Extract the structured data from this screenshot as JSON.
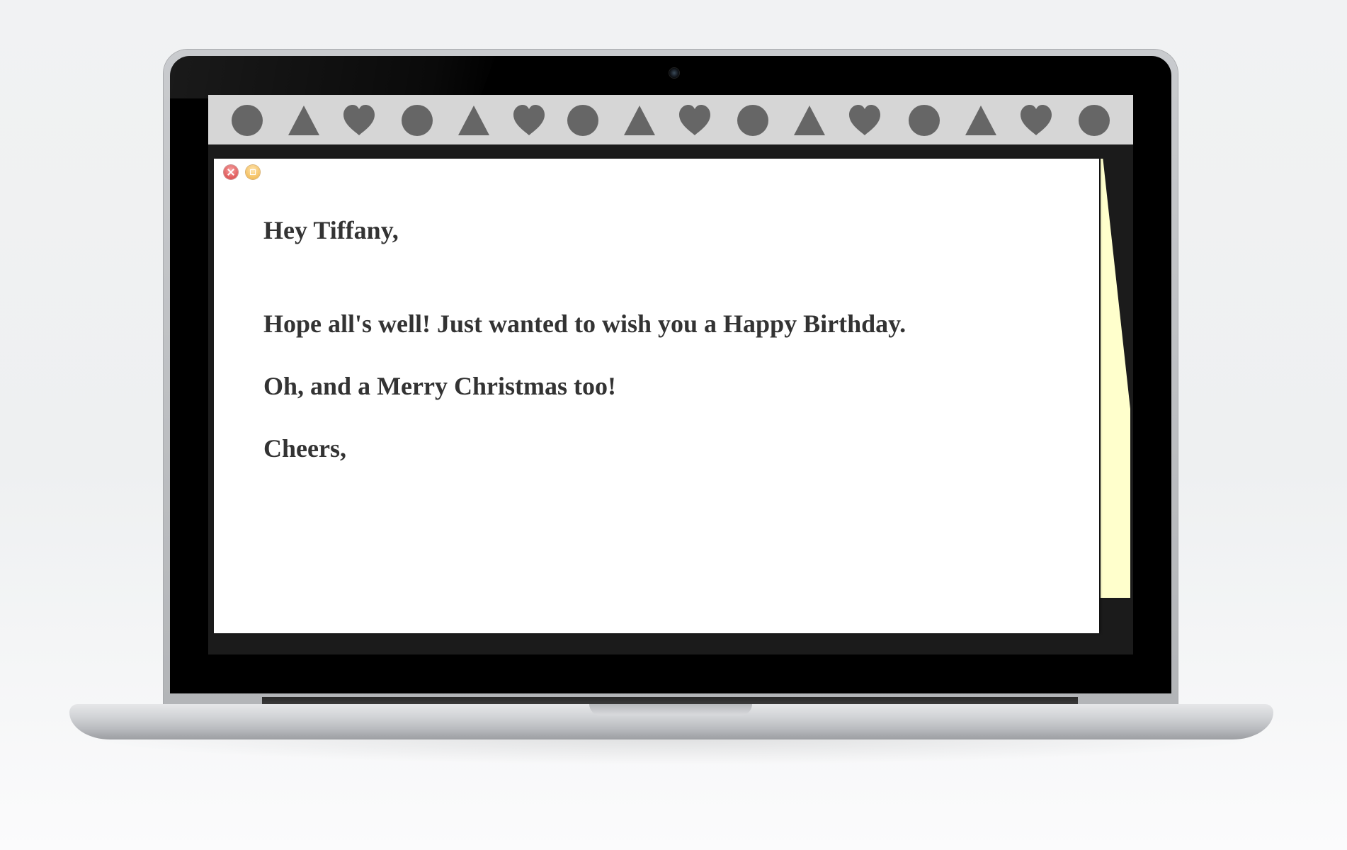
{
  "toolbar": {
    "icons": [
      "circle-icon",
      "triangle-icon",
      "heart-icon",
      "circle-icon",
      "triangle-icon",
      "heart-icon",
      "circle-icon",
      "triangle-icon",
      "heart-icon",
      "circle-icon",
      "triangle-icon",
      "heart-icon",
      "circle-icon",
      "triangle-icon",
      "heart-icon",
      "circle-icon"
    ],
    "icon_color": "#666666",
    "background_color": "#d6d6d6"
  },
  "note": {
    "background_color": "#ffffff",
    "text_color": "#333333",
    "greeting": "Hey Tiffany,",
    "line1": "Hope all's well! Just wanted to wish you a Happy Birthday.",
    "line2": "Oh, and a Merry Christmas too!",
    "closing": "Cheers,"
  },
  "window_controls": {
    "close_icon": "close-icon",
    "minimize_icon": "minimize-icon"
  },
  "side_note": {
    "color": "#ffffcc"
  }
}
